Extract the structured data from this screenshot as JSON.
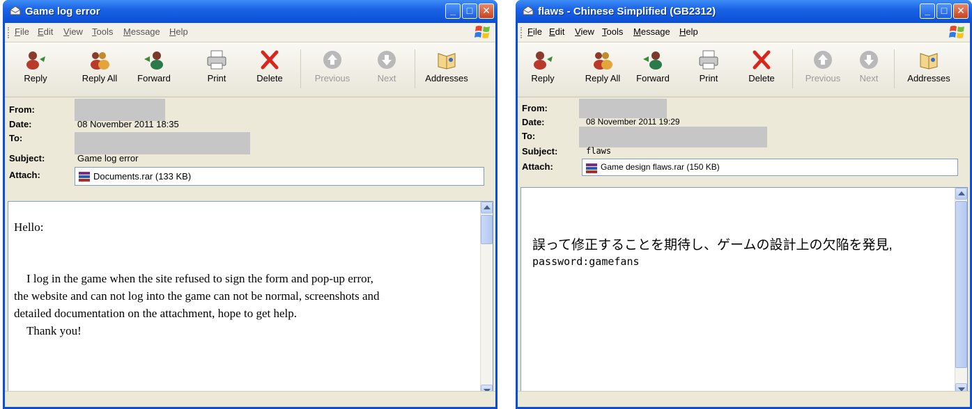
{
  "menu_labels": [
    "File",
    "Edit",
    "View",
    "Tools",
    "Message",
    "Help"
  ],
  "toolbar": {
    "reply": "Reply",
    "reply_all": "Reply All",
    "forward": "Forward",
    "print": "Print",
    "delete": "Delete",
    "previous": "Previous",
    "next": "Next",
    "addresses": "Addresses"
  },
  "header_labels": {
    "from": "From:",
    "date": "Date:",
    "to": "To:",
    "subject": "Subject:",
    "attach": "Attach:"
  },
  "window1": {
    "title": "Game log error",
    "date": "08 November 2011 18:35",
    "subject": "Game log error",
    "attachment": "Documents.rar (133 KB)",
    "body": {
      "greeting": "Hello:",
      "line1": "I log in the game when the site refused to sign the form and pop-up error,",
      "line2": "the website and can not log into the game can not be normal, screenshots and",
      "line3": "detailed documentation on the attachment, hope to get help.",
      "line4": "Thank you!"
    }
  },
  "window2": {
    "title": "flaws - Chinese Simplified (GB2312)",
    "date": "08 November 2011 19:29",
    "subject": "flaws",
    "attachment": "Game design flaws.rar (150 KB)",
    "body": {
      "line1": "誤って修正することを期待し、ゲームの設計上の欠陥を発見,",
      "line2": "password:gamefans"
    }
  }
}
